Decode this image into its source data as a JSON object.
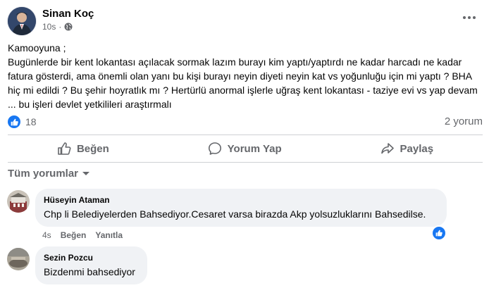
{
  "post": {
    "author": "Sinan Koç",
    "time": "10s",
    "text": "Kamooyuna ;\nBugünlerde bir kent lokantası açılacak sormak lazım burayı kim yaptı/yaptırdı ne kadar harcadı ne kadar fatura gösterdi, ama önemli olan yanı bu kişi burayı neyin diyeti neyin kat vs yoğunluğu için mi yaptı ? BHA hiç mi edildi ? Bu şehir hoyratlık mı ? Hertürlü anormal işlerle uğraş kent lokantası - taziye evi vs yap devam ... bu işleri devlet yetkilileri araştırmalı",
    "reaction_count": "18",
    "comment_count": "2 yorum"
  },
  "actions": {
    "like": "Beğen",
    "comment": "Yorum Yap",
    "share": "Paylaş"
  },
  "sort_label": "Tüm yorumlar",
  "comments": [
    {
      "author": "Hüseyin Ataman",
      "text": "Chp li Belediyelerden Bahsediyor.Cesaret varsa birazda Akp yolsuzluklarını Bahsedilse.",
      "time": "4s",
      "like": "Beğen",
      "reply": "Yanıtla"
    },
    {
      "author": "Sezin Pozcu",
      "text": "Bizdenmi bahsediyor"
    }
  ],
  "colors": {
    "accent": "#1877f2",
    "secondary_text": "#65676b",
    "bubble": "#f0f2f5"
  },
  "icons": [
    "globe-icon",
    "more-icon",
    "like-icon",
    "comment-icon",
    "share-icon",
    "chevron-down-icon"
  ]
}
